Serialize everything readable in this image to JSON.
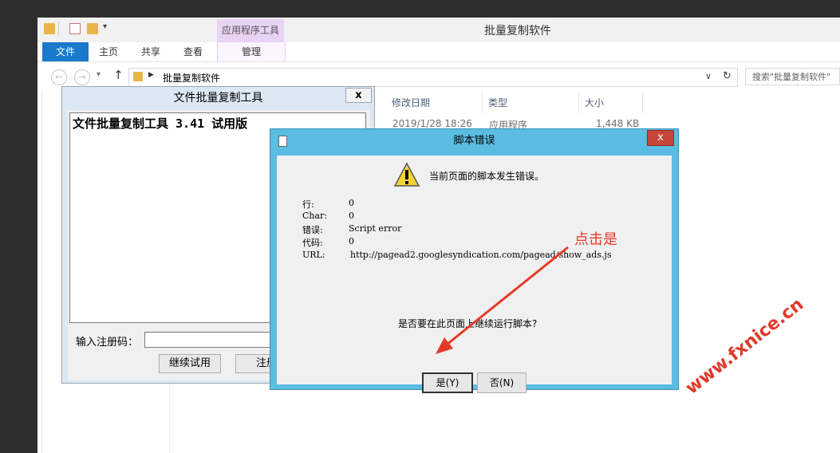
{
  "explorer": {
    "title": "批量复制软件",
    "ribbon_tabs": [
      "文件",
      "主页",
      "共享",
      "查看"
    ],
    "context_tab_group": "应用程序工具",
    "context_tab": "管理",
    "breadcrumb": "批量复制软件",
    "search_placeholder": "搜索\"批量复制软件\"",
    "columns": [
      "修改日期",
      "类型",
      "大小"
    ],
    "row": {
      "date": "2019/1/28 18:26",
      "type": "应用程序",
      "size": "1,448 KB"
    }
  },
  "tool_window": {
    "title": "文件批量复制工具",
    "close": "x",
    "content": "文件批量复制工具 3.41 试用版",
    "reg_label": "输入注册码：",
    "continue_button": "继续试用",
    "register_button": "注册"
  },
  "error_dialog": {
    "title": "脚本错误",
    "close": "x",
    "message": "当前页面的脚本发生错误。",
    "fields": [
      {
        "label": "行:",
        "value": "0"
      },
      {
        "label": "Char:",
        "value": "0"
      },
      {
        "label": "错误:",
        "value": "Script error"
      },
      {
        "label": "代码:",
        "value": "0"
      },
      {
        "label": "URL:",
        "value": "http://pagead2.googlesyndication.com/pagead/show_ads.js"
      }
    ],
    "question": "是否要在此页面上继续运行脚本?",
    "yes_button": "是(Y)",
    "no_button": "否(N)"
  },
  "annotation": "点击是",
  "watermark": "www.fxnice.cn",
  "colors": {
    "accent": "#1979ca",
    "dialog_frame": "#5bbde2",
    "close_red": "#c7463b",
    "annotation_red": "#e53a2a"
  }
}
